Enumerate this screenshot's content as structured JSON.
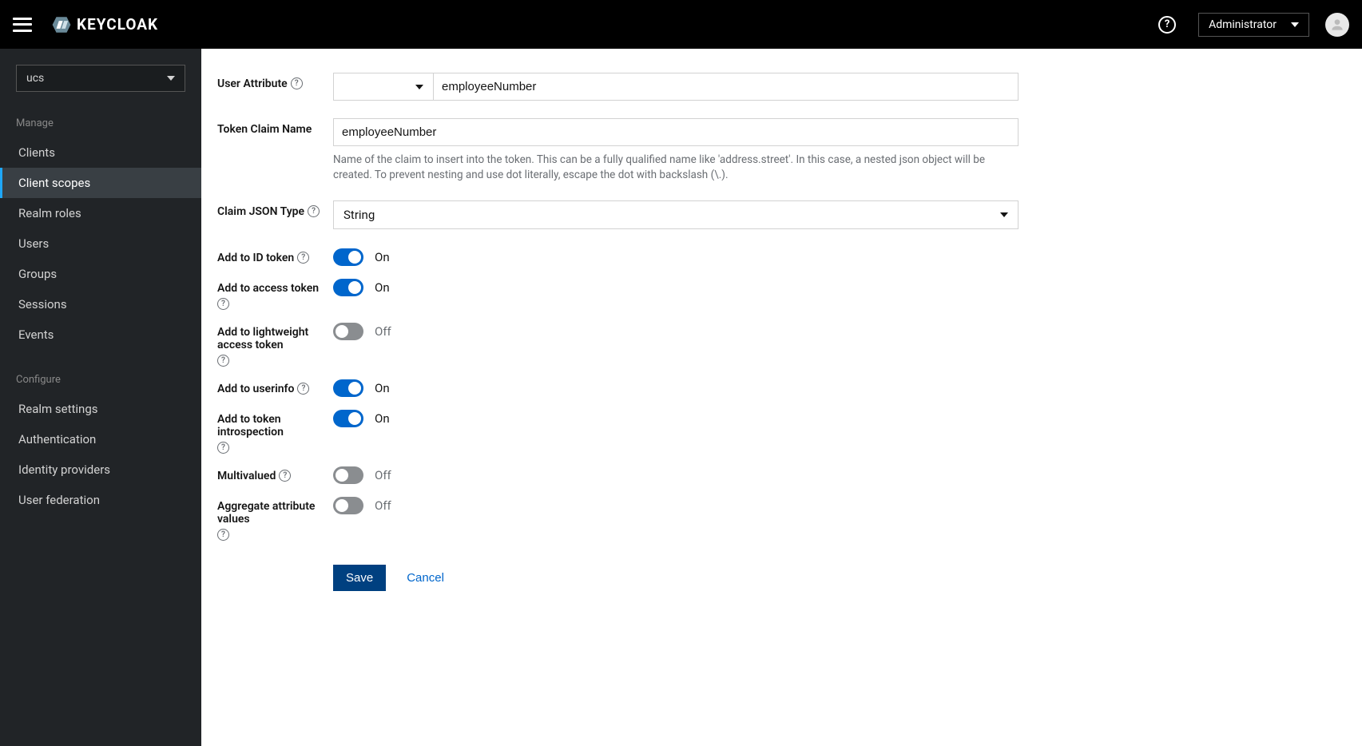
{
  "header": {
    "brand": "KEYCLOAK",
    "user_label": "Administrator"
  },
  "sidebar": {
    "realm": "ucs",
    "section_manage": "Manage",
    "section_configure": "Configure",
    "manage_items": [
      {
        "label": "Clients"
      },
      {
        "label": "Client scopes"
      },
      {
        "label": "Realm roles"
      },
      {
        "label": "Users"
      },
      {
        "label": "Groups"
      },
      {
        "label": "Sessions"
      },
      {
        "label": "Events"
      }
    ],
    "configure_items": [
      {
        "label": "Realm settings"
      },
      {
        "label": "Authentication"
      },
      {
        "label": "Identity providers"
      },
      {
        "label": "User federation"
      }
    ]
  },
  "form": {
    "user_attribute_label": "User Attribute",
    "user_attribute_value": "employeeNumber",
    "token_claim_name_label": "Token Claim Name",
    "token_claim_name_value": "employeeNumber",
    "token_claim_help": "Name of the claim to insert into the token. This can be a fully qualified name like 'address.street'. In this case, a nested json object will be created. To prevent nesting and use dot literally, escape the dot with backslash (\\.).",
    "claim_json_type_label": "Claim JSON Type",
    "claim_json_type_value": "String",
    "add_id_token_label": "Add to ID token",
    "add_access_token_label": "Add to access token",
    "add_lightweight_label": "Add to lightweight access token",
    "add_userinfo_label": "Add to userinfo",
    "add_introspection_label": "Add to token introspection",
    "multivalued_label": "Multivalued",
    "aggregate_label": "Aggregate attribute values",
    "on_text": "On",
    "off_text": "Off",
    "save": "Save",
    "cancel": "Cancel"
  },
  "toggles": {
    "add_id_token": true,
    "add_access_token": true,
    "add_lightweight": false,
    "add_userinfo": true,
    "add_introspection": true,
    "multivalued": false,
    "aggregate": false
  }
}
